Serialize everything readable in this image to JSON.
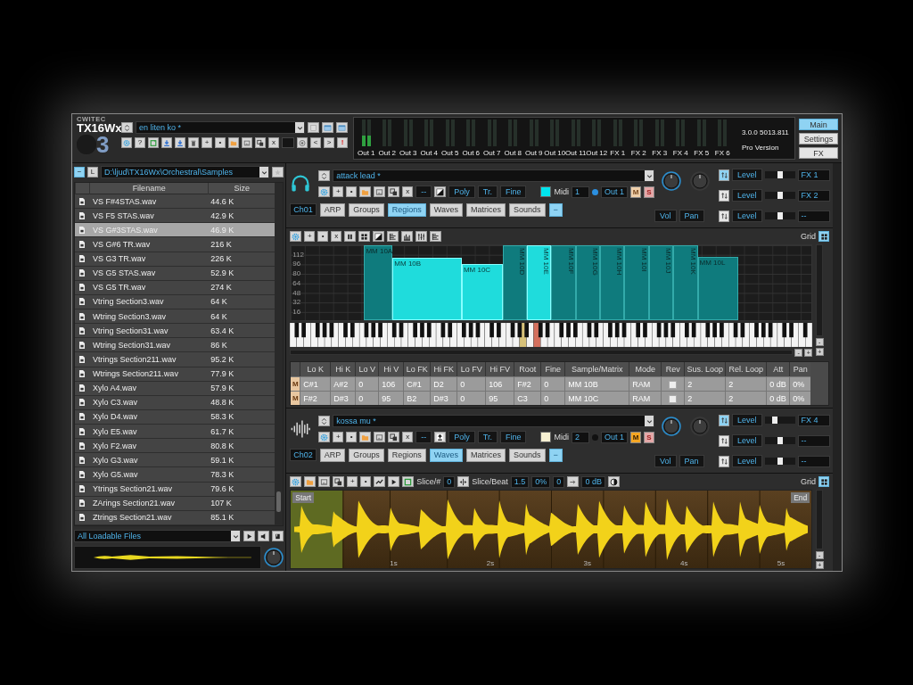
{
  "header": {
    "brand": "CWITEC",
    "product": "TX16Wx",
    "version_mark": "3",
    "preset": "en liten ko *",
    "toolbar": [
      {
        "kind": "icon"
      },
      {
        "kind": "text",
        "label": "?"
      },
      {
        "kind": "icon"
      },
      {
        "kind": "icon"
      },
      {
        "kind": "icon"
      },
      {
        "kind": "icon"
      },
      {
        "kind": "text",
        "label": "+"
      },
      {
        "kind": "text",
        "label": "•"
      },
      {
        "kind": "icon"
      },
      {
        "kind": "icon"
      },
      {
        "kind": "icon"
      },
      {
        "kind": "text",
        "label": "x"
      },
      {
        "kind": "blank"
      },
      {
        "kind": "icon"
      },
      {
        "kind": "text",
        "label": "<"
      },
      {
        "kind": "text",
        "label": ">"
      },
      {
        "kind": "alert",
        "label": "!"
      }
    ],
    "meters": [
      {
        "label": "Out 1",
        "level": 0.4
      },
      {
        "label": "Out 2",
        "level": 0
      },
      {
        "label": "Out 3",
        "level": 0
      },
      {
        "label": "Out 4",
        "level": 0
      },
      {
        "label": "Out 5",
        "level": 0
      },
      {
        "label": "Out 6",
        "level": 0
      },
      {
        "label": "Out 7",
        "level": 0
      },
      {
        "label": "Out 8",
        "level": 0
      },
      {
        "label": "Out 9",
        "level": 0
      },
      {
        "label": "Out 10",
        "level": 0
      },
      {
        "label": "Out 11",
        "level": 0
      },
      {
        "label": "Out 12",
        "level": 0
      },
      {
        "label": "FX 1",
        "level": 0
      },
      {
        "label": "FX 2",
        "level": 0
      },
      {
        "label": "FX 3",
        "level": 0
      },
      {
        "label": "FX 4",
        "level": 0
      },
      {
        "label": "FX 5",
        "level": 0
      },
      {
        "label": "FX 6",
        "level": 0
      }
    ],
    "version": "3.0.0 5013.811",
    "edition": "Pro Version",
    "views": [
      {
        "label": "Main",
        "selected": true
      },
      {
        "label": "Settings",
        "selected": false
      },
      {
        "label": "FX",
        "selected": false
      }
    ]
  },
  "browser": {
    "collapse": "−",
    "drive": "L",
    "path": "D:\\ljud\\TX16Wx\\Orchestral\\Samples",
    "columns": [
      "Filename",
      "Size"
    ],
    "files": [
      {
        "name": "VS F#4STAS.wav",
        "size": "44.6 K",
        "selected": false
      },
      {
        "name": "VS F5 STAS.wav",
        "size": "42.9 K",
        "selected": false
      },
      {
        "name": "VS G#3STAS.wav",
        "size": "46.9 K",
        "selected": true
      },
      {
        "name": "VS G#6 TR.wav",
        "size": "216 K",
        "selected": false
      },
      {
        "name": "VS G3 TR.wav",
        "size": "226 K",
        "selected": false
      },
      {
        "name": "VS G5 STAS.wav",
        "size": "52.9 K",
        "selected": false
      },
      {
        "name": "VS G5 TR.wav",
        "size": "274 K",
        "selected": false
      },
      {
        "name": "Vtring Section3.wav",
        "size": "64 K",
        "selected": false
      },
      {
        "name": "Wtring Section3.wav",
        "size": "64 K",
        "selected": false
      },
      {
        "name": "Vtring Section31.wav",
        "size": "63.4 K",
        "selected": false
      },
      {
        "name": "Wtring Section31.wav",
        "size": "86 K",
        "selected": false
      },
      {
        "name": "Vtrings Section211.wav",
        "size": "95.2 K",
        "selected": false
      },
      {
        "name": "Wtrings Section211.wav",
        "size": "77.9 K",
        "selected": false
      },
      {
        "name": "Xylo A4.wav",
        "size": "57.9 K",
        "selected": false
      },
      {
        "name": "Xylo C3.wav",
        "size": "48.8 K",
        "selected": false
      },
      {
        "name": "Xylo D4.wav",
        "size": "58.3 K",
        "selected": false
      },
      {
        "name": "Xylo E5.wav",
        "size": "61.7 K",
        "selected": false
      },
      {
        "name": "Xylo F2.wav",
        "size": "80.8 K",
        "selected": false
      },
      {
        "name": "Xylo G3.wav",
        "size": "59.1 K",
        "selected": false
      },
      {
        "name": "Xylo G5.wav",
        "size": "78.3 K",
        "selected": false
      },
      {
        "name": "Ytrings Section21.wav",
        "size": "79.6 K",
        "selected": false
      },
      {
        "name": "ZArings Section21.wav",
        "size": "107 K",
        "selected": false
      },
      {
        "name": "Ztrings Section21.wav",
        "size": "85.1 K",
        "selected": false
      }
    ],
    "filter": "All Loadable Files"
  },
  "slots": [
    {
      "preset": "attack lead *",
      "toolbar": [
        {
          "kind": "icon"
        },
        {
          "kind": "text",
          "label": "+"
        },
        {
          "kind": "text",
          "label": "•"
        },
        {
          "kind": "icon"
        },
        {
          "kind": "icon"
        },
        {
          "kind": "icon"
        },
        {
          "kind": "text",
          "label": "x"
        },
        {
          "kind": "dark",
          "label": "--"
        },
        {
          "kind": "icon"
        }
      ],
      "modes": [
        "Poly",
        "Tr.",
        "Fine"
      ],
      "color": "#00e5ee",
      "midi_label": "Midi",
      "midi_channel": "1",
      "midi_active": true,
      "output": "Out 1",
      "mute": {
        "label": "M",
        "on": false
      },
      "solo": {
        "label": "S",
        "on": false
      },
      "channel": "Ch01",
      "tabs": [
        {
          "label": "ARP",
          "selected": false
        },
        {
          "label": "Groups",
          "selected": false
        },
        {
          "label": "Regions",
          "selected": true
        },
        {
          "label": "Waves",
          "selected": false
        },
        {
          "label": "Matrices",
          "selected": false
        },
        {
          "label": "Sounds",
          "selected": false
        }
      ],
      "collapse": "−",
      "vol": "Vol",
      "pan": "Pan",
      "sends": [
        {
          "label": "Level",
          "on": true,
          "level": 0.5,
          "target": "FX 1"
        },
        {
          "label": "Level",
          "on": false,
          "level": 0.5,
          "target": "FX 2"
        },
        {
          "label": "Level",
          "on": false,
          "level": 0.5,
          "target": "--"
        }
      ]
    },
    {
      "preset": "kossa mu *",
      "toolbar": [
        {
          "kind": "icon"
        },
        {
          "kind": "text",
          "label": "+"
        },
        {
          "kind": "text",
          "label": "•"
        },
        {
          "kind": "icon"
        },
        {
          "kind": "icon"
        },
        {
          "kind": "icon"
        },
        {
          "kind": "text",
          "label": "x"
        },
        {
          "kind": "dark",
          "label": "--"
        },
        {
          "kind": "icon"
        }
      ],
      "modes": [
        "Poly",
        "Tr.",
        "Fine"
      ],
      "color": "#f6f0d2",
      "midi_label": "Midi",
      "midi_channel": "2",
      "midi_active": false,
      "output": "Out 1",
      "mute": {
        "label": "M",
        "on": true
      },
      "solo": {
        "label": "S",
        "on": false
      },
      "channel": "Ch02",
      "tabs": [
        {
          "label": "ARP",
          "selected": false
        },
        {
          "label": "Groups",
          "selected": false
        },
        {
          "label": "Regions",
          "selected": false
        },
        {
          "label": "Waves",
          "selected": true
        },
        {
          "label": "Matrices",
          "selected": false
        },
        {
          "label": "Sounds",
          "selected": false
        }
      ],
      "collapse": "−",
      "vol": "Vol",
      "pan": "Pan",
      "sends": [
        {
          "label": "Level",
          "on": true,
          "level": 0.35,
          "target": "FX 4"
        },
        {
          "label": "Level",
          "on": false,
          "level": 0.5,
          "target": "--"
        },
        {
          "label": "Level",
          "on": false,
          "level": 0.5,
          "target": "--"
        }
      ]
    }
  ],
  "region_editor": {
    "toolbar": [
      {
        "kind": "icon"
      },
      {
        "kind": "text",
        "label": "+"
      },
      {
        "kind": "text",
        "label": "•"
      },
      {
        "kind": "text",
        "label": "x"
      },
      {
        "kind": "icon"
      },
      {
        "kind": "icon"
      },
      {
        "kind": "icon"
      },
      {
        "kind": "icon"
      },
      {
        "kind": "icon"
      },
      {
        "kind": "icon"
      },
      {
        "kind": "icon"
      }
    ],
    "grid_label": "Grid",
    "grid_on": true,
    "velocity_labels": [
      "112",
      "96",
      "80",
      "64",
      "48",
      "32",
      "16"
    ],
    "regions": [
      {
        "label": "MM 10A",
        "selected": false
      },
      {
        "label": "MM 10B",
        "selected": true
      },
      {
        "label": "MM 10C",
        "selected": true
      },
      {
        "label": "MM 10D",
        "selected": false
      },
      {
        "label": "MM 10E",
        "selected": true
      },
      {
        "label": "MM 10F",
        "selected": false
      },
      {
        "label": "MM 10G",
        "selected": false
      },
      {
        "label": "MM 10H",
        "selected": false
      },
      {
        "label": "MM 10I",
        "selected": false
      },
      {
        "label": "MM 10J",
        "selected": false
      },
      {
        "label": "MM 10K",
        "selected": false
      },
      {
        "label": "MM 10L",
        "selected": false
      }
    ],
    "pressed_keys": [
      {
        "color": "#d8c27a"
      },
      {
        "color": "#d4705e"
      }
    ],
    "zoom_buttons": [
      "-",
      "+"
    ],
    "scroll_buttons": [
      "-",
      "+"
    ],
    "table": {
      "columns": [
        "Lo K",
        "Hi K",
        "Lo V",
        "Hi V",
        "Lo FK",
        "Hi FK",
        "Lo FV",
        "Hi FV",
        "Root",
        "Fine",
        "Sample/Matrix",
        "Mode",
        "Rev",
        "Sus. Loop",
        "Rel. Loop",
        "Att",
        "Pan"
      ],
      "rows": [
        {
          "marker": "M",
          "cells": [
            "C#1",
            "A#2",
            "0",
            "106",
            "C#1",
            "D2",
            "0",
            "106",
            "F#2",
            "0",
            "MM 10B",
            "RAM",
            "",
            "2",
            "2",
            "0 dB",
            "0%"
          ],
          "rev": false
        },
        {
          "marker": "M",
          "cells": [
            "F#2",
            "D#3",
            "0",
            "95",
            "B2",
            "D#3",
            "0",
            "95",
            "C3",
            "0",
            "MM 10C",
            "RAM",
            "",
            "2",
            "2",
            "0 dB",
            "0%"
          ],
          "rev": false
        }
      ]
    }
  },
  "wave_editor": {
    "toolbar": [
      {
        "kind": "icon"
      },
      {
        "kind": "icon"
      },
      {
        "kind": "icon"
      },
      {
        "kind": "icon"
      },
      {
        "kind": "text",
        "label": "+"
      },
      {
        "kind": "text",
        "label": "•"
      },
      {
        "kind": "icon"
      },
      {
        "kind": "icon"
      },
      {
        "kind": "icon"
      },
      {
        "kind": "label",
        "label": "Slice/#"
      },
      {
        "kind": "field",
        "label": "0"
      },
      {
        "kind": "icon"
      },
      {
        "kind": "label",
        "label": "Slice/Beat"
      },
      {
        "kind": "field",
        "label": "1.5"
      },
      {
        "kind": "field",
        "label": "0%"
      },
      {
        "kind": "field",
        "label": "0"
      },
      {
        "kind": "icon"
      },
      {
        "kind": "field",
        "label": "0 dB"
      },
      {
        "kind": "icon"
      }
    ],
    "grid_label": "Grid",
    "grid_on": true,
    "start": "Start",
    "end": "End",
    "time_labels": [
      "1s",
      "2s",
      "3s",
      "4s",
      "5s"
    ],
    "zoom_buttons": [
      "-",
      "+"
    ]
  }
}
